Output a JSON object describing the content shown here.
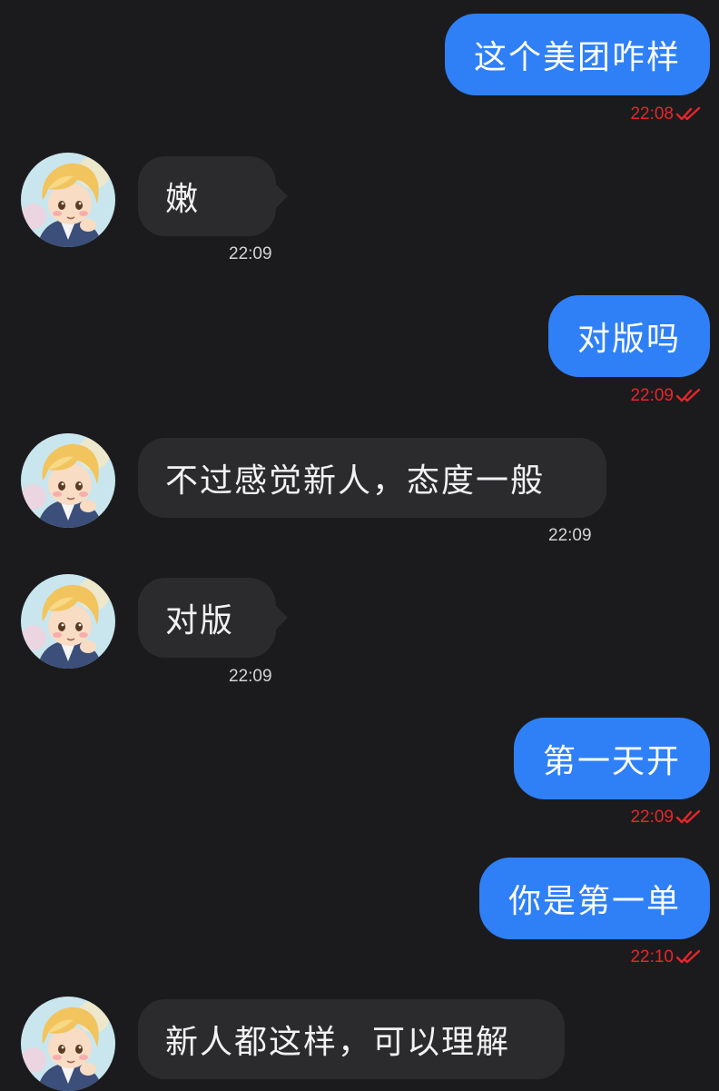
{
  "colors": {
    "background": "#1b1b1d",
    "outgoing_bubble": "#2f80f6",
    "incoming_bubble": "#2b2b2e",
    "outgoing_time": "#e5262b",
    "read_ticks": "#e5262b",
    "incoming_time": "#d4d4d4"
  },
  "messages": [
    {
      "direction": "outgoing",
      "text": "这个美团咋样",
      "time": "22:08",
      "status_icon": "double-check-icon"
    },
    {
      "direction": "incoming",
      "text": "嫩",
      "time": "22:09",
      "avatar_icon": "avatar-anime-boy-icon"
    },
    {
      "direction": "outgoing",
      "text": "对版吗",
      "time": "22:09",
      "status_icon": "double-check-icon"
    },
    {
      "direction": "incoming",
      "text": "不过感觉新人，态度一般",
      "time": "22:09",
      "avatar_icon": "avatar-anime-boy-icon"
    },
    {
      "direction": "incoming",
      "text": "对版",
      "time": "22:09",
      "avatar_icon": "avatar-anime-boy-icon"
    },
    {
      "direction": "outgoing",
      "text": "第一天开",
      "time": "22:09",
      "status_icon": "double-check-icon"
    },
    {
      "direction": "outgoing",
      "text": "你是第一单",
      "time": "22:10",
      "status_icon": "double-check-icon"
    },
    {
      "direction": "incoming",
      "text": "新人都这样，可以理解",
      "time": "",
      "avatar_icon": "avatar-anime-boy-icon"
    }
  ]
}
